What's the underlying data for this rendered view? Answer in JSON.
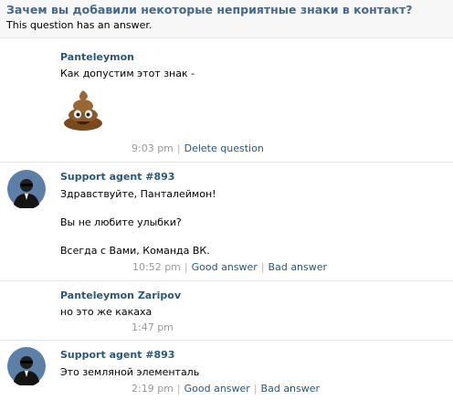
{
  "question": {
    "title": "Зачем вы добавили некоторые неприятные знаки в контакт?",
    "status": "This question has an answer."
  },
  "messages": [
    {
      "author": "Panteleymon",
      "lines": [
        "Как допустим этот знак -"
      ],
      "attachment_icon": "poop-emoji-icon",
      "time": "9:03 pm",
      "actions": [
        "Delete question"
      ]
    },
    {
      "author": "Support agent #893",
      "avatar_icon": "support-agent-avatar-icon",
      "lines": [
        "Здравствуйте, Панталеймон!",
        "Вы не любите улыбки?",
        "Всегда с Вами, Команда ВК."
      ],
      "time": "10:52 pm",
      "actions": [
        "Good answer",
        "Bad answer"
      ]
    },
    {
      "author": "Panteleymon Zaripov",
      "lines": [
        "но это же какаха"
      ],
      "time": "1:47 pm",
      "actions": []
    },
    {
      "author": "Support agent #893",
      "avatar_icon": "support-agent-avatar-icon",
      "lines": [
        "Это земляной элементаль"
      ],
      "time": "2:19 pm",
      "actions": [
        "Good answer",
        "Bad answer"
      ]
    }
  ],
  "colors": {
    "link": "#2b587a",
    "title": "#45688e",
    "muted": "#999999",
    "avatar_bg": "#5b7fa6"
  }
}
